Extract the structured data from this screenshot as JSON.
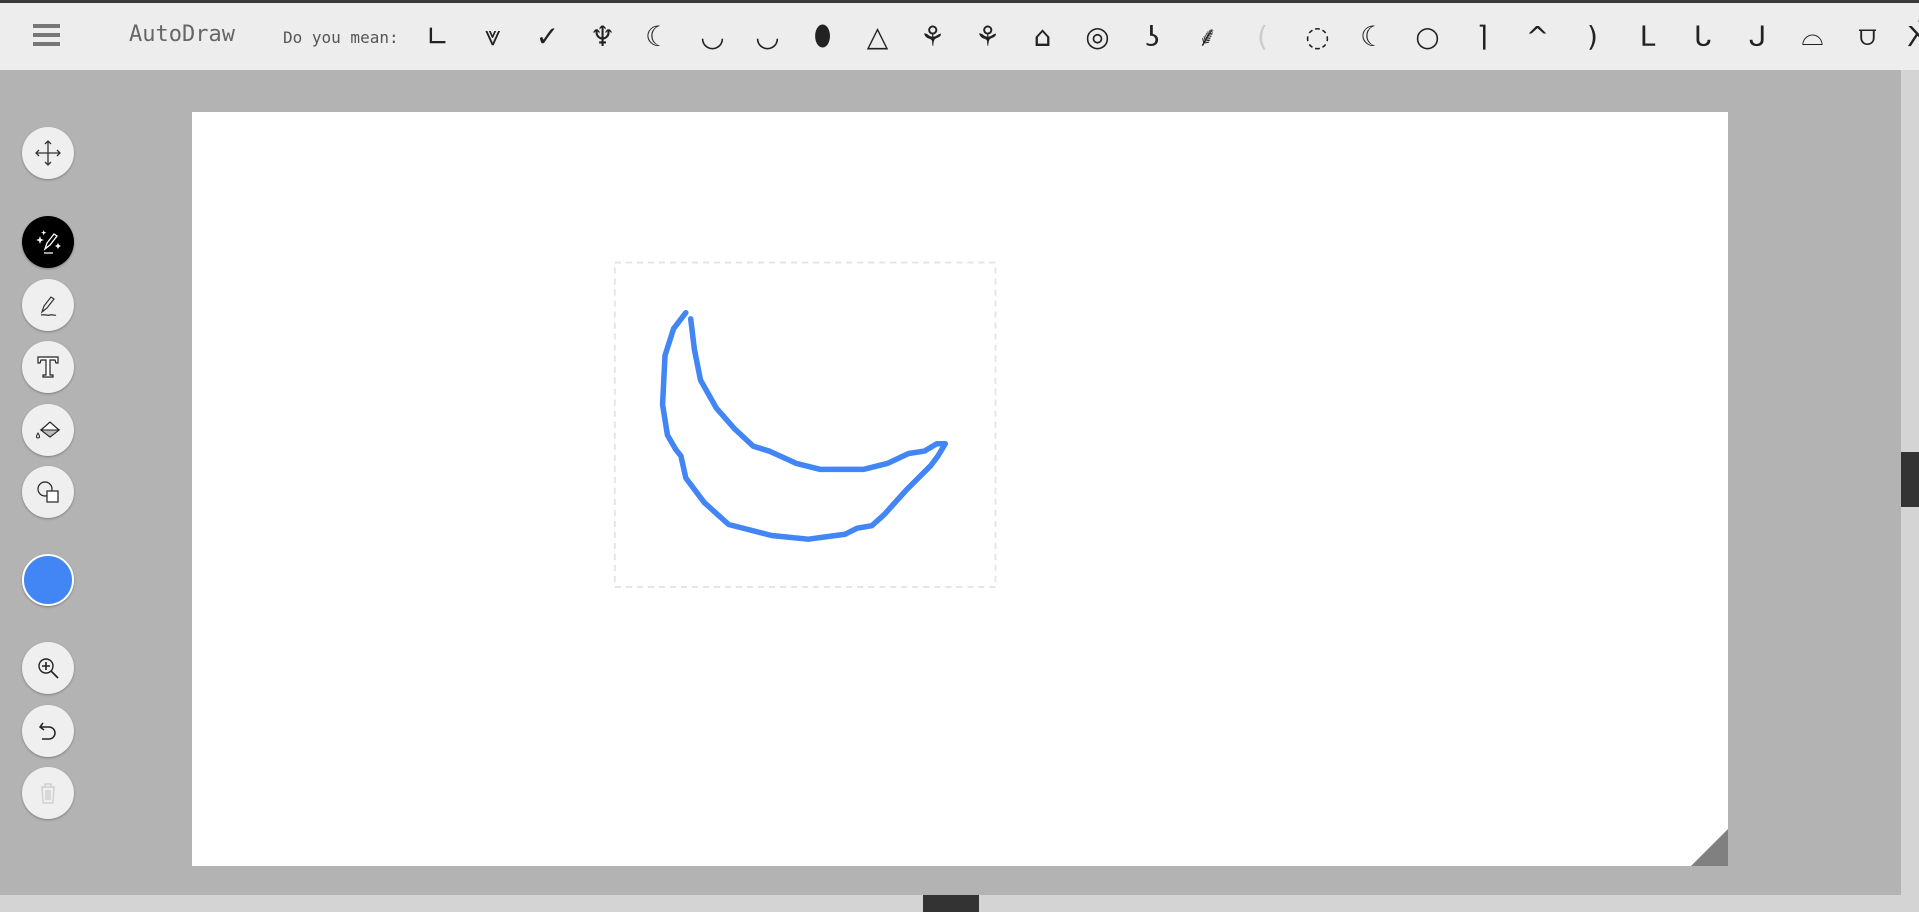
{
  "app": {
    "title": "AutoDraw"
  },
  "header": {
    "suggest_label": "Do you mean:",
    "suggestions": [
      {
        "icon": "arm-icon",
        "glyph": "∟"
      },
      {
        "icon": "bird-icon",
        "glyph": "⩔"
      },
      {
        "icon": "check-bird-icon",
        "glyph": "✓"
      },
      {
        "icon": "banana-peeled-icon",
        "glyph": "♆"
      },
      {
        "icon": "banana-bunch-icon",
        "glyph": "☾"
      },
      {
        "icon": "banana-icon",
        "glyph": "◡"
      },
      {
        "icon": "bowl-icon",
        "glyph": "◡"
      },
      {
        "icon": "watermelon-icon",
        "glyph": "⬮"
      },
      {
        "icon": "watermelon-slice-icon",
        "glyph": "△"
      },
      {
        "icon": "garden-planter-icon",
        "glyph": "⚘"
      },
      {
        "icon": "flower-pots-icon",
        "glyph": "⚘"
      },
      {
        "icon": "house-icon",
        "glyph": "⌂"
      },
      {
        "icon": "hose-reel-icon",
        "glyph": "◎"
      },
      {
        "icon": "hose-nozzle-icon",
        "glyph": "ʖ"
      },
      {
        "icon": "sprinkler-icon",
        "glyph": "⸙"
      },
      {
        "icon": "faint-crescent-icon",
        "glyph": "("
      },
      {
        "icon": "moon-icon",
        "glyph": "◌"
      },
      {
        "icon": "crescent-moon-icon",
        "glyph": "☾"
      },
      {
        "icon": "full-moon-icon",
        "glyph": "○"
      },
      {
        "icon": "pipe-elbow-icon",
        "glyph": "⌉"
      },
      {
        "icon": "boomerang-icon",
        "glyph": "^"
      },
      {
        "icon": "boomerang-wave-icon",
        "glyph": ")"
      },
      {
        "icon": "flexed-arm-icon",
        "glyph": "ᒪ"
      },
      {
        "icon": "arm-hand-icon",
        "glyph": "ᒐ"
      },
      {
        "icon": "forearm-icon",
        "glyph": "ᒍ"
      },
      {
        "icon": "canoe-icon",
        "glyph": "⌓"
      },
      {
        "icon": "bridge-icon",
        "glyph": "⩌"
      },
      {
        "icon": "insect-icon",
        "glyph": "Ӂ"
      }
    ]
  },
  "toolbar": {
    "tools": [
      "move",
      "autodraw",
      "draw",
      "type",
      "fill",
      "shape",
      "color",
      "zoom",
      "undo",
      "delete"
    ],
    "active_tool": "autodraw",
    "color": "#4285f4"
  },
  "canvas": {
    "stroke_color": "#4285f4"
  }
}
